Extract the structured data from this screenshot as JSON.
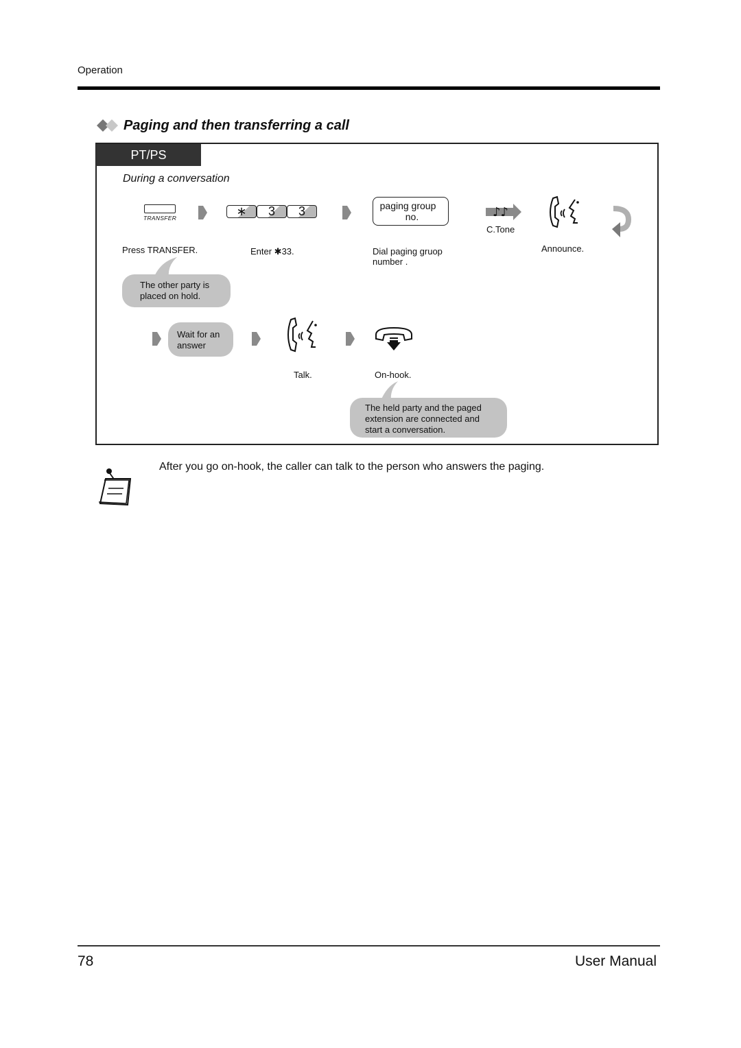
{
  "header": {
    "section": "Operation"
  },
  "section": {
    "title": "Paging and then transferring a call",
    "title_icon": "double-diamond-icon",
    "device_tab": "PT/PS",
    "condition": "During a conversation"
  },
  "steps_row1": [
    {
      "icon": "transfer-button-icon",
      "key_caption": "TRANSFER",
      "label": "Press TRANSFER."
    },
    {
      "icon": "keypad-keys",
      "keys": [
        "∗",
        "3",
        "3"
      ],
      "label": "Enter ✱33."
    },
    {
      "icon": "paging-group-box",
      "box_line1": "paging group",
      "box_line2": "no.",
      "label_line1": "Dial paging gruop",
      "label_line2": "number  ."
    },
    {
      "icon": "confirmation-tone-icon",
      "caption": "C.Tone"
    },
    {
      "icon": "talk-handset-icon",
      "label": "Announce."
    }
  ],
  "bubbles": {
    "hold": "The other party is placed on hold.",
    "wait_line1": "Wait for an",
    "wait_line2": "answer",
    "result_line1": "The held party and the paged",
    "result_line2": "extension are connected and",
    "result_line3": "start a conversation."
  },
  "steps_row2": [
    {
      "icon": "talk-handset-icon",
      "label": "Talk."
    },
    {
      "icon": "on-hook-icon",
      "label": "On-hook."
    }
  ],
  "note": {
    "icon": "notepad-icon",
    "text": "After you go on-hook, the caller can talk to the person who answers the paging."
  },
  "footer": {
    "page_number": "78",
    "manual_title": "User Manual"
  },
  "colors": {
    "tab_bg": "#333333",
    "bubble_bg": "#c3c3c3",
    "arrow_gray": "#8a8a8a"
  }
}
